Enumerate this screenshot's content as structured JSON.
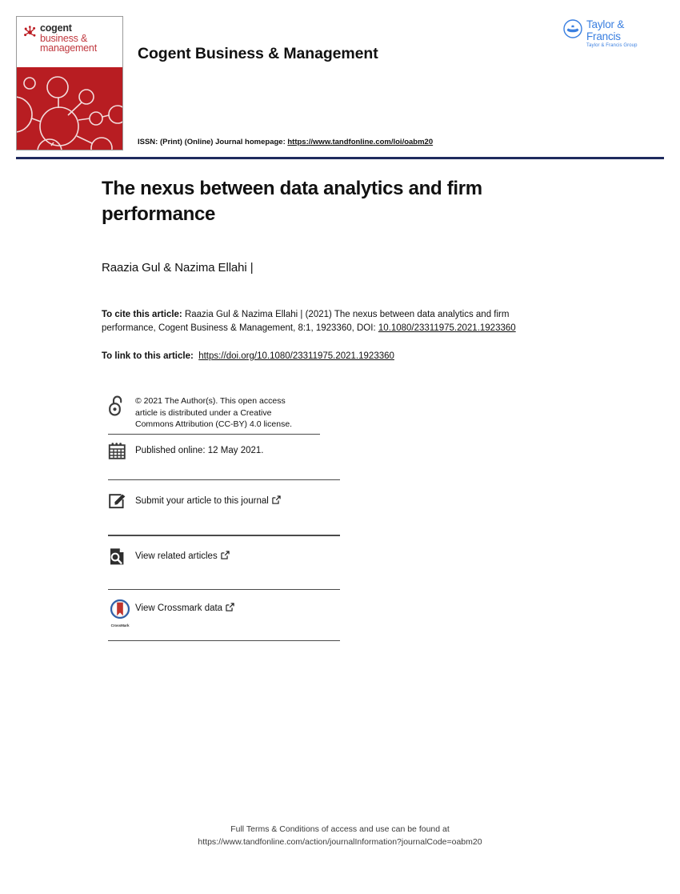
{
  "header": {
    "cover": {
      "brand_line1": "cogent",
      "brand_line2": "business &",
      "brand_line3": "management",
      "logo_icon": "cogent-asterisk-icon",
      "graphic_icon": "molecular-network-graphic",
      "accent_color": "#b81d22"
    },
    "journal_title": "Cogent Business & Management",
    "publisher_logo": {
      "name": "Taylor & Francis",
      "group": "Taylor & Francis Group",
      "icon": "taylor-francis-badge-icon",
      "color": "#3a7fe0"
    },
    "issn": {
      "prefix": "ISSN: (Print) (Online) Journal homepage: ",
      "homepage_url": "https://www.tandfonline.com/loi/oabm20"
    },
    "rule_color": "#1f2a5e"
  },
  "article": {
    "title": "The nexus between data analytics and firm performance",
    "authors": "Raazia Gul & Nazima Ellahi |",
    "citation": {
      "label": "To cite this article:",
      "text": " Raazia Gul & Nazima Ellahi | (2021) The nexus between data analytics and firm performance, Cogent Business & Management, 8:1, 1923360, DOI: ",
      "doi": "10.1080/23311975.2021.1923360"
    },
    "link": {
      "label": "To link to this article:",
      "url": "https://doi.org/10.1080/23311975.2021.1923360"
    }
  },
  "metadata": {
    "open_access": {
      "icon": "open-access-lock-icon",
      "line1": "© 2021 The Author(s). This open access",
      "line2": "article is distributed under a Creative",
      "line3": "Commons Attribution (CC-BY) 4.0 license."
    },
    "published": {
      "icon": "calendar-icon",
      "text": "Published online: 12 May 2021."
    },
    "submit": {
      "icon": "pencil-square-icon",
      "text": "Submit your article to this journal",
      "external_icon": "external-link-icon"
    },
    "related": {
      "icon": "document-search-icon",
      "text": "View related articles",
      "external_icon": "external-link-icon"
    },
    "crossmark": {
      "icon": "crossmark-logo-icon",
      "caption": "CrossMark",
      "text": "View Crossmark data",
      "external_icon": "external-link-icon"
    }
  },
  "footer": {
    "line1": "Full Terms & Conditions of access and use can be found at",
    "line2": "https://www.tandfonline.com/action/journalInformation?journalCode=oabm20"
  }
}
